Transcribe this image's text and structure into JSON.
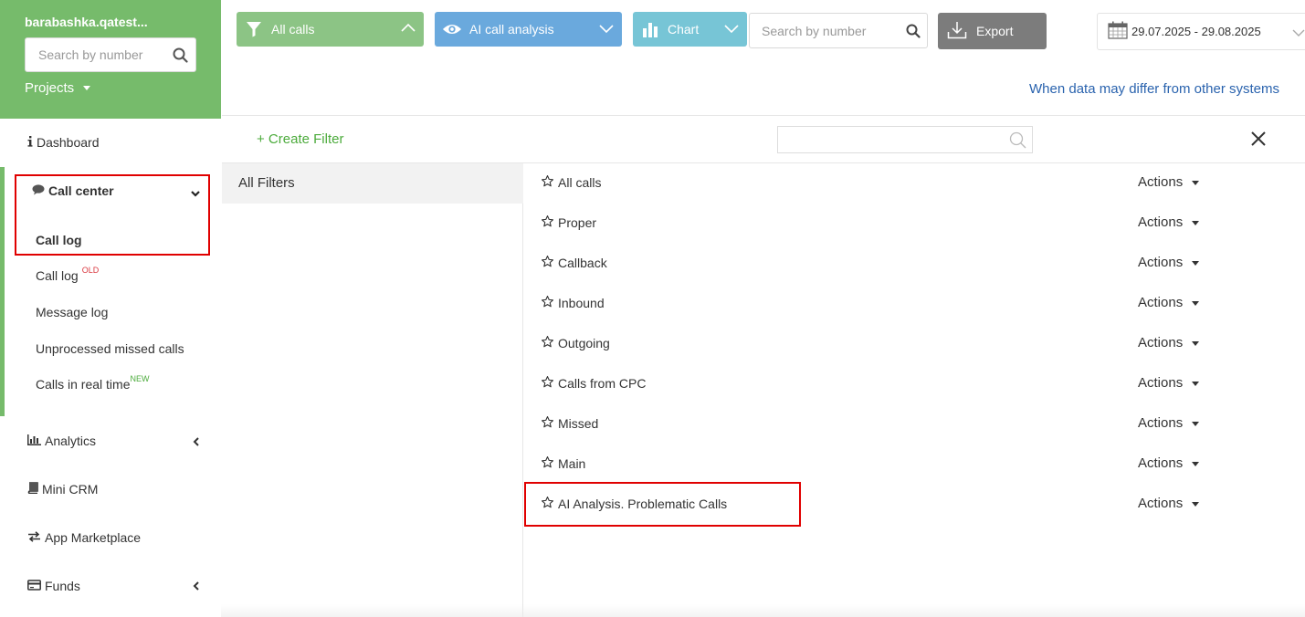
{
  "sidebar": {
    "account_name": "barabashka.qatest...",
    "search_placeholder": "Search by number",
    "projects_label": "Projects",
    "dashboard_label": "Dashboard",
    "call_center": {
      "title": "Call center",
      "items": [
        {
          "label": "Call log",
          "active": true
        },
        {
          "label": "Call log",
          "badge": "OLD"
        },
        {
          "label": "Message log"
        },
        {
          "label": "Unprocessed missed calls"
        },
        {
          "label": "Calls in real time",
          "badge": "NEW"
        }
      ]
    },
    "sections": [
      {
        "label": "Analytics",
        "icon": "bar-chart-icon"
      },
      {
        "label": "Mini CRM",
        "icon": "book-icon"
      },
      {
        "label": "App Marketplace",
        "icon": "exchange-icon"
      },
      {
        "label": "Funds",
        "icon": "credit-card-icon"
      }
    ]
  },
  "toolbar": {
    "all_calls_label": "All calls",
    "ai_label": "AI call analysis",
    "chart_label": "Chart",
    "search_placeholder": "Search by number",
    "export_label": "Export",
    "date_range": "29.07.2025 - 29.08.2025",
    "info_link": "When data may differ from other systems"
  },
  "filter_panel": {
    "create_filter_label": "+ Create Filter",
    "categories": [
      "All Filters"
    ],
    "actions_label": "Actions",
    "filters": [
      "All calls",
      "Proper",
      "Callback",
      "Inbound",
      "Outgoing",
      "Calls from CPC",
      "Missed",
      "Main",
      "AI Analysis. Problematic Calls"
    ]
  },
  "colors": {
    "sidebar_header": "#76bb6b",
    "all_calls_button": "#8cc485",
    "ai_button": "#6aa9dd",
    "chart_button": "#77c5d6",
    "export_button": "#7c7c7c",
    "highlight_border": "#e00000",
    "link": "#2a63ae",
    "create_filter": "#4cab3c"
  }
}
